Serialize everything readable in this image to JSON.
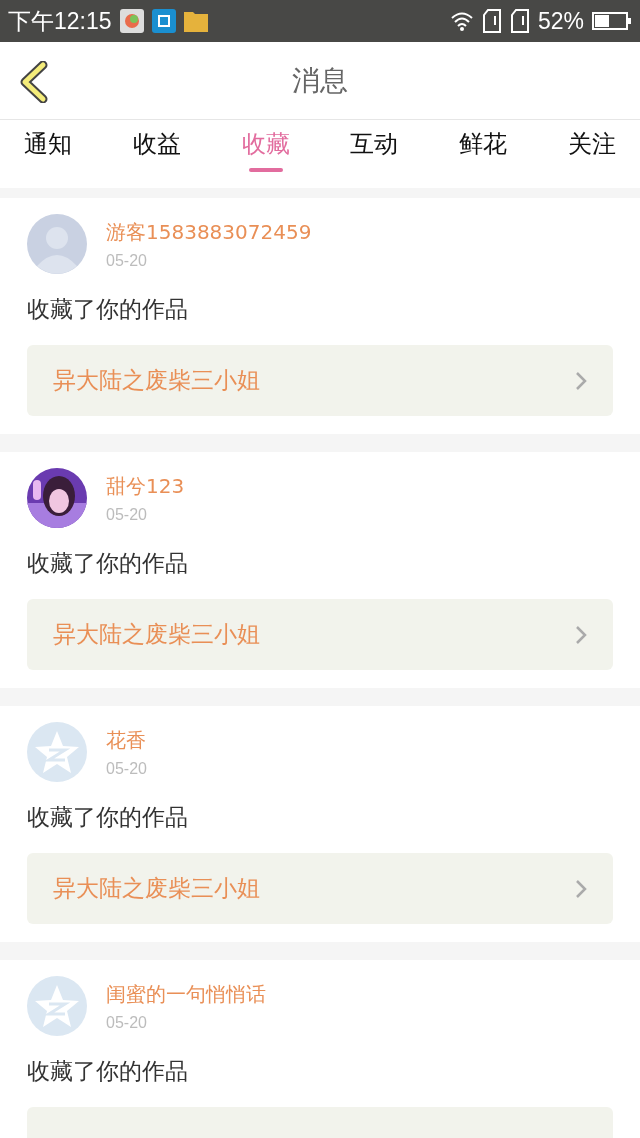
{
  "status_bar": {
    "time": "下午12:15",
    "battery_percent": "52%"
  },
  "header": {
    "title": "消息"
  },
  "tabs": [
    {
      "label": "通知",
      "selected": false
    },
    {
      "label": "收益",
      "selected": false
    },
    {
      "label": "收藏",
      "selected": true
    },
    {
      "label": "互动",
      "selected": false
    },
    {
      "label": "鲜花",
      "selected": false
    },
    {
      "label": "关注",
      "selected": false
    }
  ],
  "messages": [
    {
      "avatar": {
        "kind": "default"
      },
      "name": "游客1583883072459",
      "date": "05-20",
      "text": "收藏了你的作品",
      "work": "异大陆之废柴三小姐"
    },
    {
      "name": "甜兮123",
      "date": "05-20",
      "text": "收藏了你的作品",
      "work": "异大陆之废柴三小姐"
    },
    {
      "avatar": {
        "kind": "star"
      },
      "name": "花香",
      "date": "05-20",
      "text": "收藏了你的作品",
      "work": "异大陆之废柴三小姐"
    },
    {
      "avatar": {
        "kind": "star"
      },
      "name": "闺蜜的一句悄悄话",
      "date": "05-20",
      "text": "收藏了你的作品"
    }
  ]
}
